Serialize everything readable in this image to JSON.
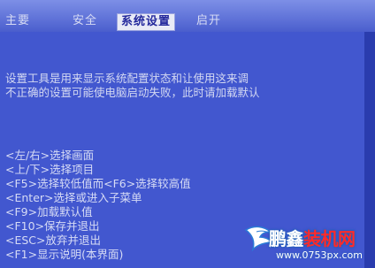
{
  "menu": {
    "tabs": [
      {
        "label": "主要"
      },
      {
        "label": "安全"
      },
      {
        "label": "系统设置"
      },
      {
        "label": "启开"
      }
    ]
  },
  "description": {
    "line1": "设置工具是用来显示系统配置状态和让使用这来调",
    "line2": "不正确的设置可能使电脑启动失败，此时请加载默认"
  },
  "help": {
    "items": [
      "<左/右>选择画面",
      "<上/下>选择项目",
      "<F5>选择较低值而<F6>选择较高值",
      "<Enter>选择或进入子菜单",
      "<F9>加载默认值",
      "<F10>保存并退出",
      "<ESC>放弃并退出",
      "<F1>显示说明(本界面)"
    ]
  },
  "watermark": {
    "title_part1": "鹏鑫",
    "title_part2": "装机网",
    "url": "www.0753px.com"
  },
  "colors": {
    "background": "#4257cf",
    "menubar": "#5f72d8",
    "active_tab": "#e8eaf6",
    "text": "#d3d8f2",
    "watermark_accent": "#ff2a2a"
  }
}
